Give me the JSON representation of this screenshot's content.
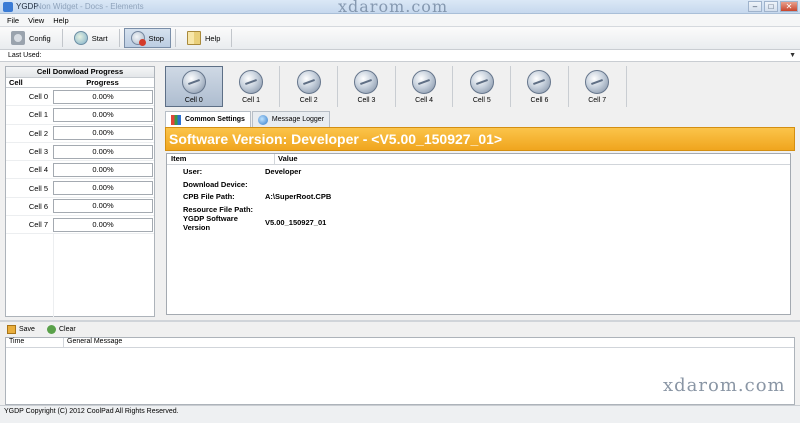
{
  "window": {
    "title": "YGDP",
    "title_faded": "Non Widget - Docs - Elements",
    "watermark": "xdarom.com",
    "controls": [
      "–",
      "□",
      "✕"
    ]
  },
  "menu": [
    "File",
    "View",
    "Help"
  ],
  "toolbar": {
    "config_label": "Config",
    "start_label": "Start",
    "stop_label": "Stop",
    "help_label": "Help",
    "active": "Stop"
  },
  "last_used": {
    "label": "Last Used:",
    "value": ""
  },
  "progress_panel": {
    "title": "Cell Donwload Progress",
    "col_cell": "Cell",
    "col_progress": "Progress",
    "rows": [
      {
        "cell": "Cell 0",
        "progress": "0.00%"
      },
      {
        "cell": "Cell 1",
        "progress": "0.00%"
      },
      {
        "cell": "Cell 2",
        "progress": "0.00%"
      },
      {
        "cell": "Cell 3",
        "progress": "0.00%"
      },
      {
        "cell": "Cell 4",
        "progress": "0.00%"
      },
      {
        "cell": "Cell 5",
        "progress": "0.00%"
      },
      {
        "cell": "Cell 6",
        "progress": "0.00%"
      },
      {
        "cell": "Cell 7",
        "progress": "0.00%"
      }
    ]
  },
  "cells": {
    "selected": "Cell 0",
    "items": [
      "Cell 0",
      "Cell 1",
      "Cell 2",
      "Cell 3",
      "Cell 4",
      "Cell 5",
      "Cell 6",
      "Cell 7"
    ]
  },
  "tabs": [
    {
      "label": "Common Settings",
      "icon": "chart-icon",
      "selected": true
    },
    {
      "label": "Message Logger",
      "icon": "globe-icon",
      "selected": false
    }
  ],
  "banner": "Software Version:  Developer - <V5.00_150927_01>",
  "info_panel": {
    "col_item": "Item",
    "col_value": "Value",
    "rows": [
      {
        "key": "User:",
        "value": "Developer"
      },
      {
        "key": "Download Device:",
        "value": ""
      },
      {
        "key": "CPB File Path:",
        "value": "A:\\SuperRoot.CPB"
      },
      {
        "key": "Resource File Path:",
        "value": ""
      },
      {
        "key": "YGDP Software Version",
        "value": "V5.00_150927_01"
      }
    ]
  },
  "log": {
    "save_label": "Save",
    "clear_label": "Clear",
    "col_time": "Time",
    "col_message": "General Message"
  },
  "status": "YGDP Copyright (C) 2012 CoolPad All Rights Reserved."
}
